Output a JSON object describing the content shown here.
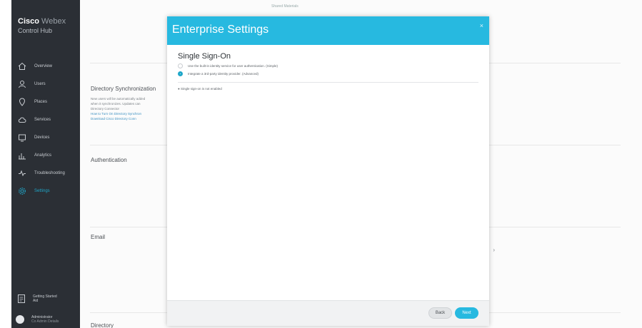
{
  "sidebar": {
    "brand_bold": "Cisco",
    "brand_light": "Webex",
    "brand_sub": "Control Hub",
    "items": [
      {
        "label": "Overview",
        "icon": "home-icon"
      },
      {
        "label": "Users",
        "icon": "user-icon"
      },
      {
        "label": "Places",
        "icon": "location-pin-icon"
      },
      {
        "label": "Services",
        "icon": "cloud-icon"
      },
      {
        "label": "Devices",
        "icon": "device-icon"
      },
      {
        "label": "Analytics",
        "icon": "bar-chart-icon"
      },
      {
        "label": "Troubleshooting",
        "icon": "pulse-icon"
      },
      {
        "label": "Settings",
        "icon": "gear-icon"
      }
    ],
    "active_item": "Settings",
    "help_line1": "Getting Started",
    "help_line2": "Aid",
    "user_line1": "Administrator",
    "user_line2": "Co Admin Details"
  },
  "background": {
    "top_text": "Shared Materials",
    "directory_sync_label": "Directory Synchronization",
    "directory_sync_text1": "New users will be automatically added",
    "directory_sync_text2": "when it synchronizes. Updates can",
    "directory_sync_text3": "Directory Connector",
    "directory_sync_link1": "How to Turn On Directory Synchron",
    "directory_sync_link2": "Download Cisco Directory Conn",
    "authentication_label": "Authentication",
    "email_label": "Email",
    "bottom_label": "Directory"
  },
  "modal": {
    "title": "Enterprise Settings",
    "close_glyph": "×",
    "section_title": "Single Sign-On",
    "options": [
      {
        "label": "Use the built-in identity service for user authentication. (Simple)",
        "checked": false
      },
      {
        "label": "Integrate a 3rd-party identity provider. (Advanced)",
        "checked": true
      }
    ],
    "note": "● Single sign-on is not enabled",
    "back_label": "Back",
    "next_label": "Next"
  },
  "colors": {
    "accent": "#27b9e0",
    "sidebar_bg": "#2b2f35"
  }
}
